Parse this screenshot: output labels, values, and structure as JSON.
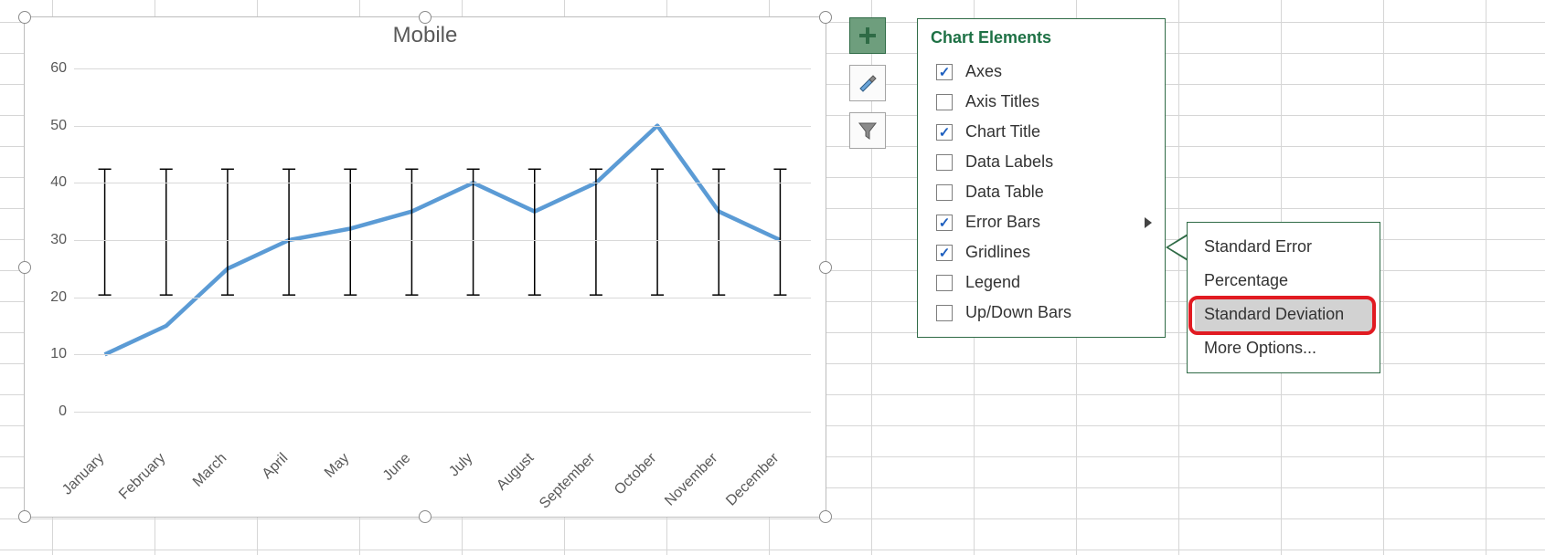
{
  "chart_data": {
    "type": "line",
    "title": "Mobile",
    "xlabel": "",
    "ylabel": "",
    "ylim": [
      0,
      60
    ],
    "y_ticks": [
      0,
      10,
      20,
      30,
      40,
      50,
      60
    ],
    "categories": [
      "January",
      "February",
      "March",
      "April",
      "May",
      "June",
      "July",
      "August",
      "September",
      "October",
      "November",
      "December"
    ],
    "values": [
      10,
      15,
      25,
      30,
      32,
      35,
      40,
      35,
      40,
      50,
      35,
      30
    ],
    "error_bar_center": 31.4,
    "error_bar_half": 11
  },
  "flyout": {
    "plus_title": "Chart Elements",
    "brush_title": "Chart Styles",
    "filter_title": "Chart Filters"
  },
  "panel": {
    "title": "Chart Elements",
    "items": [
      {
        "label": "Axes",
        "checked": true
      },
      {
        "label": "Axis Titles",
        "checked": false
      },
      {
        "label": "Chart Title",
        "checked": true
      },
      {
        "label": "Data Labels",
        "checked": false
      },
      {
        "label": "Data Table",
        "checked": false
      },
      {
        "label": "Error Bars",
        "checked": true,
        "submenu": true
      },
      {
        "label": "Gridlines",
        "checked": true
      },
      {
        "label": "Legend",
        "checked": false
      },
      {
        "label": "Up/Down Bars",
        "checked": false
      }
    ]
  },
  "submenu": {
    "items": [
      {
        "label": "Standard Error"
      },
      {
        "label": "Percentage"
      },
      {
        "label": "Standard Deviation",
        "selected": true
      },
      {
        "label": "More Options..."
      }
    ]
  }
}
